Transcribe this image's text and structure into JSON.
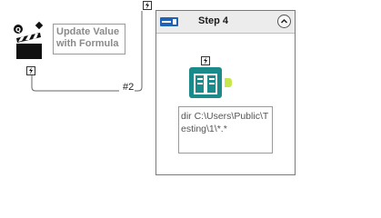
{
  "canvas": {
    "left_tool": {
      "annotation": "Update Value with Formula",
      "badge_icon": "q-badge-icon",
      "icon": "clapper-board-icon"
    },
    "connection_label": "#2",
    "container": {
      "title": "Step 4",
      "header_icon": "container-toggle-icon",
      "collapse_icon": "chevron-up-icon",
      "tool": {
        "icon": "directory-book-icon",
        "annotation": "dir C:\\Users\\Public\\Testing\\1\\*.*",
        "accent_color": "#1a8a8a"
      }
    },
    "colors": {
      "connector": "#666666",
      "container_header": "#ececec"
    }
  }
}
